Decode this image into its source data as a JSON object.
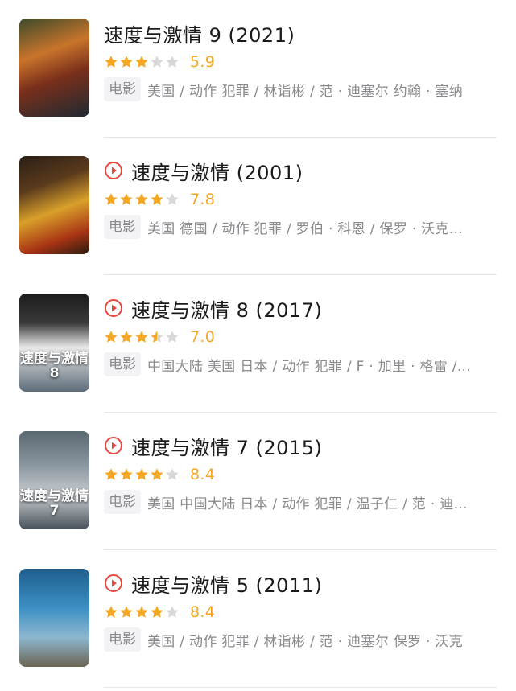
{
  "colors": {
    "star_on": "#f5a623",
    "star_off": "#d8d8d8",
    "play": "#e8453c",
    "score": "#f5a623"
  },
  "movies": [
    {
      "title": "速度与激情 9 (2021)",
      "playable": false,
      "stars": 3,
      "score": "5.9",
      "badge": "电影",
      "info": "美国 / 动作 犯罪 / 林诣彬 / 范 · 迪塞尔 约翰 · 塞纳",
      "poster_text": "",
      "poster_bg": "linear-gradient(160deg,#3b4a2a 0%,#c9742b 35%,#7a2f1b 60%,#1f2a33 100%)"
    },
    {
      "title": "速度与激情  (2001)",
      "playable": true,
      "stars": 4,
      "score": "7.8",
      "badge": "电影",
      "info": "美国 德国 / 动作 犯罪 / 罗伯 · 科恩 / 保罗 · 沃克...",
      "poster_text": "",
      "poster_bg": "linear-gradient(160deg,#2a1f16 0%,#5a3a1c 30%,#d9a02a 55%,#a83414 80%,#2b1b10 100%)"
    },
    {
      "title": "速度与激情 8 (2017)",
      "playable": true,
      "stars": 3.5,
      "score": "7.0",
      "badge": "电影",
      "info": "中国大陆 美国 日本 / 动作 犯罪 / F · 加里 · 格雷 /...",
      "poster_text": "速度与激情8",
      "poster_bg": "linear-gradient(180deg,#1c1c1c 0%,#3a3a3a 30%,#e9e9e9 55%,#5b6b78 100%)"
    },
    {
      "title": "速度与激情 7 (2015)",
      "playable": true,
      "stars": 4,
      "score": "8.4",
      "badge": "电影",
      "info": "美国 中国大陆 日本 / 动作 犯罪 / 温子仁 / 范 · 迪...",
      "poster_text": "速度与激情7",
      "poster_bg": "linear-gradient(180deg,#5a6870 0%,#8b97a0 35%,#c8ccd0 65%,#48525a 100%)"
    },
    {
      "title": "速度与激情 5 (2011)",
      "playable": true,
      "stars": 4,
      "score": "8.4",
      "badge": "电影",
      "info": "美国 / 动作 犯罪 / 林诣彬 / 范 · 迪塞尔 保罗 · 沃克",
      "poster_text": "",
      "poster_bg": "linear-gradient(180deg,#1e5f8e 0%,#3d8fc4 40%,#8db7cf 70%,#6b6452 100%)"
    }
  ]
}
